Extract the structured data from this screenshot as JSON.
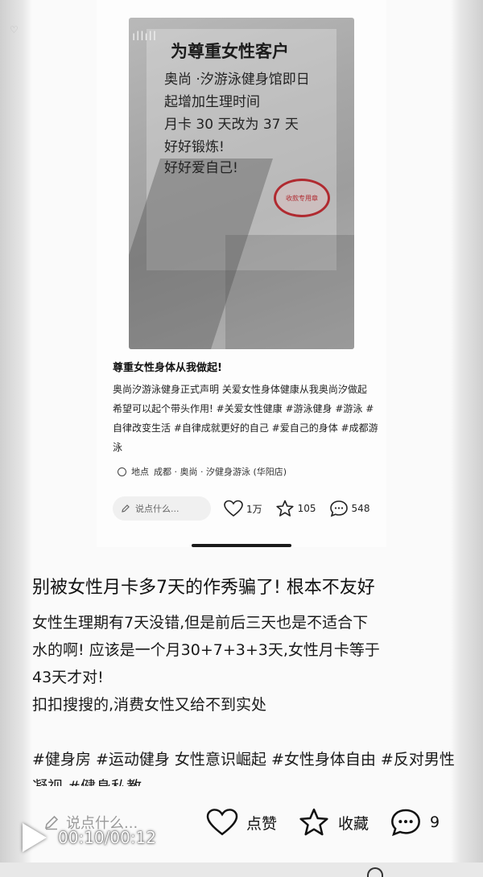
{
  "embedded_post": {
    "photo": {
      "status_signal": "ıllıll",
      "notice_title": "为尊重女性客户",
      "notice_lines": [
        "奥尚 ·汐游泳健身馆即日",
        "起增加生理时间",
        "月卡 30 天改为 37 天",
        "好好锻炼!",
        "好好爱自己!"
      ],
      "seal_text": "收款专用章"
    },
    "title": "尊重女性身体从我做起!",
    "body": "奥尚汐游泳健身正式声明 关爱女性身体健康从我奥尚汐做起 希望可以起个带头作用! #关爱女性健康 #游泳健身 #游泳 #自律改变生活 #自律成就更好的自己 #爱自己的身体 #成都游泳",
    "location_prefix": "地点",
    "location": "成都 · 奥尚 · 汐健身游泳 (华阳店)",
    "comment_placeholder": "说点什么...",
    "likes": "1万",
    "favorites": "105",
    "comments": "548"
  },
  "outer_post": {
    "title": "别被女性月卡多7天的作秀骗了! 根本不友好",
    "body_lines": [
      "女性生理期有7天没错,但是前后三天也是不适合下",
      "水的啊! 应该是一个月30+7+3+3天,女性月卡等于",
      "43天才对!",
      "扣扣搜搜的,消费女性又给不到实处"
    ],
    "tags": "#健身房 #运动健身 女性意识崛起 #女性身体自由 #反对男性凝视 #健身私教"
  },
  "bottom_bar": {
    "comment_placeholder": "说点什么...",
    "like_label": "点赞",
    "favorite_label": "收藏",
    "comment_count": "9"
  },
  "player": {
    "timecode": "00:10/00:12"
  },
  "icons": {
    "pencil": "pencil-icon",
    "heart": "heart-icon",
    "star": "star-icon",
    "comment": "comment-bubble-icon",
    "location": "location-pin-icon",
    "play": "play-icon"
  },
  "colors": {
    "seal": "#b02a30",
    "text": "#111111",
    "muted": "#9a9a9a"
  }
}
